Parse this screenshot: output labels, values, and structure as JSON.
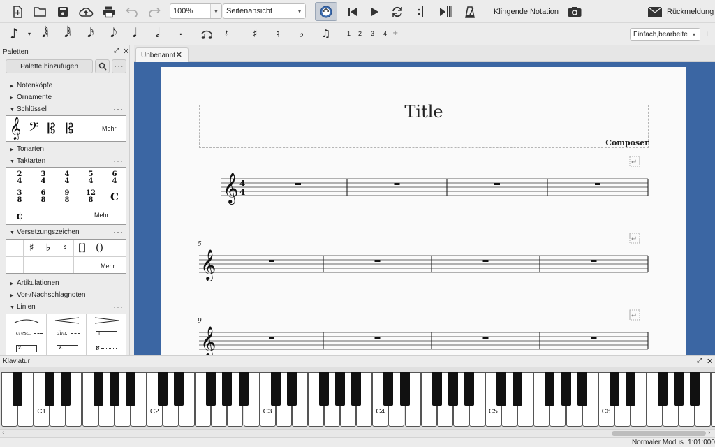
{
  "toolbar": {
    "zoom_value": "100%",
    "view_mode": "Seitenansicht",
    "concert_pitch": "Klingende Notation",
    "feedback": "Rückmeldung"
  },
  "note_toolbar": {
    "voices": [
      "1",
      "2",
      "3",
      "4"
    ],
    "workspace": "Einfach,bearbeitet"
  },
  "palettes": {
    "title": "Paletten",
    "add_button": "Palette hinzufügen",
    "sections": {
      "noteheads": "Notenköpfe",
      "ornaments": "Ornamente",
      "clefs": "Schlüssel",
      "keysigs": "Tonarten",
      "timesigs": "Taktarten",
      "accidentals": "Versetzungszeichen",
      "articulations": "Artikulationen",
      "grace": "Vor-/Nachschlagnoten",
      "lines": "Linien"
    },
    "more": "Mehr",
    "timesig_cells": [
      "2/4",
      "3/4",
      "4/4",
      "5/4",
      "6/4",
      "3/8",
      "6/8",
      "9/8",
      "12/8",
      "C",
      "¢"
    ],
    "lines_cells": [
      "cresc.",
      "dim.",
      "1.",
      "2.",
      "2.",
      "8"
    ]
  },
  "tab": {
    "label": "Unbenannt"
  },
  "score": {
    "title": "Title",
    "composer": "Composer",
    "measure_numbers": [
      "5",
      "9"
    ]
  },
  "keyboard": {
    "title": "Klaviatur",
    "labels": [
      "C1",
      "C2",
      "C3",
      "C4",
      "C5",
      "C6"
    ]
  },
  "status": {
    "mode": "Normaler Modus",
    "position": "1:01:000"
  }
}
